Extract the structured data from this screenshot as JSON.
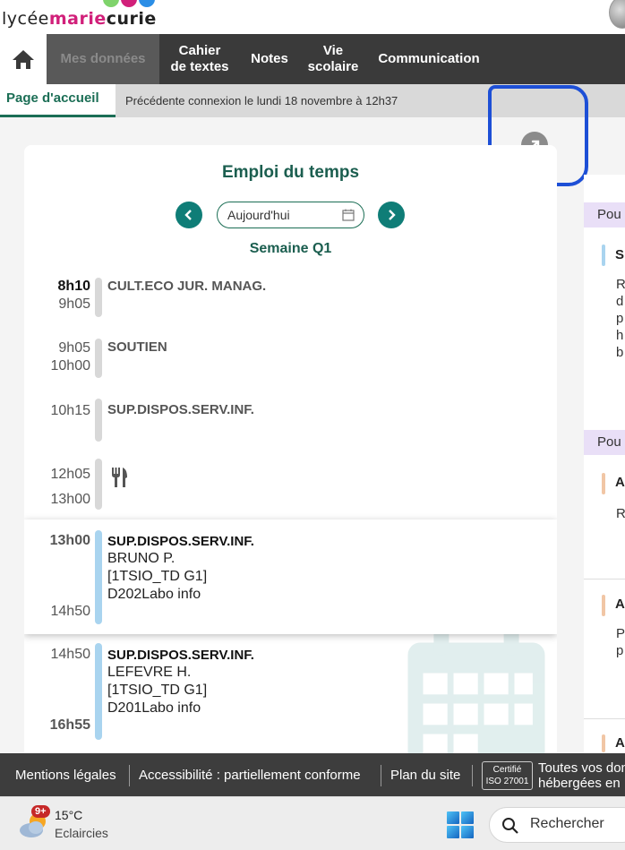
{
  "brand": {
    "prefix": "lycée",
    "marie": "marie",
    "curie": "curie"
  },
  "nav": {
    "items": [
      {
        "label": "Mes données",
        "active": true
      },
      {
        "label": "Cahier\nde textes"
      },
      {
        "label": "Notes"
      },
      {
        "label": "Vie\nscolaire"
      },
      {
        "label": "Communication"
      }
    ]
  },
  "subbar": {
    "tab": "Page d'accueil",
    "last_login": "Précédente connexion le lundi 18 novembre à 12h37"
  },
  "schedule": {
    "title": "Emploi du temps",
    "date_value": "Aujourd'hui",
    "week": "Semaine Q1",
    "slots": [
      {
        "start": "8h10",
        "end": "9h05",
        "subject": "CULT.ECO JUR. MANAG."
      },
      {
        "start": "9h05",
        "end": "10h00",
        "subject": "SOUTIEN"
      },
      {
        "start": "10h15",
        "end": "",
        "subject": "SUP.DISPOS.SERV.INF."
      },
      {
        "start": "12h05",
        "end": "13h00",
        "subject": ""
      },
      {
        "start": "13h00",
        "end": "14h50",
        "subject": "SUP.DISPOS.SERV.INF.",
        "teacher": "BRUNO P.",
        "group": "[1TSIO_TD G1]",
        "room": "D202Labo info"
      },
      {
        "start": "14h50",
        "end": "16h55",
        "subject": "SUP.DISPOS.SERV.INF.",
        "teacher": "LEFEVRE H.",
        "group": "[1TSIO_TD G1]",
        "room": "D201Labo info"
      }
    ]
  },
  "rightcol": {
    "headers": [
      "Pou",
      "Pou"
    ],
    "entries": [
      "S",
      "A",
      "A",
      "A"
    ],
    "texts": [
      "R\nd\np\nh\nb",
      "R",
      "P\np"
    ]
  },
  "footer": {
    "legal": "Mentions légales",
    "access": "Accessibilité : partiellement conforme",
    "sitemap": "Plan du site",
    "iso_line1": "Certifié",
    "iso_line2": "ISO 27001",
    "hosted_line1": "Toutes vos don",
    "hosted_line2": "hébergées en"
  },
  "taskbar": {
    "badge": "9+",
    "temp": "15°C",
    "condition": "Eclaircies",
    "search": "Rechercher"
  },
  "colors": {
    "primary": "#1b6e55",
    "nav": "#3a3a3a",
    "accent_btn": "#0f7d77",
    "highlight_bar": "#a9d4ef",
    "annotation": "#1d4fd6"
  }
}
